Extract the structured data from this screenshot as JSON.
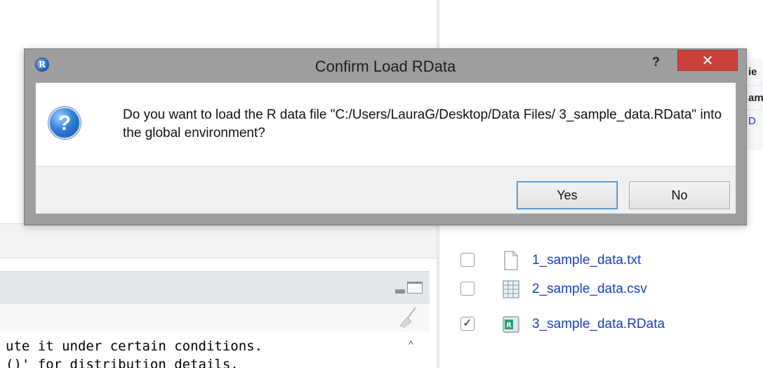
{
  "dialog": {
    "title": "Confirm Load RData",
    "r_icon_label": "R",
    "help_label": "?",
    "close_label": "✕",
    "message": "Do you want to load the R data file \"C:/Users/LauraG/Desktop/Data Files/ 3_sample_data.RData\" into the global environment?",
    "icon": "question-icon",
    "yes_label": "Yes",
    "no_label": "No"
  },
  "console": {
    "line1": "ute it under certain conditions.",
    "line2": "()' for distribution details."
  },
  "files": [
    {
      "name": "1_sample_data.txt",
      "icon": "text-file-icon",
      "checked": false
    },
    {
      "name": "2_sample_data.csv",
      "icon": "csv-file-icon",
      "checked": false
    },
    {
      "name": "3_sample_data.RData",
      "icon": "rdata-file-icon",
      "checked": true
    }
  ],
  "right_peek": {
    "header": "ie",
    "column": "am",
    "row": "D"
  },
  "colors": {
    "close_red": "#c9423a",
    "link_blue": "#1a3fb8",
    "dialog_frame": "#9e9e9e"
  }
}
